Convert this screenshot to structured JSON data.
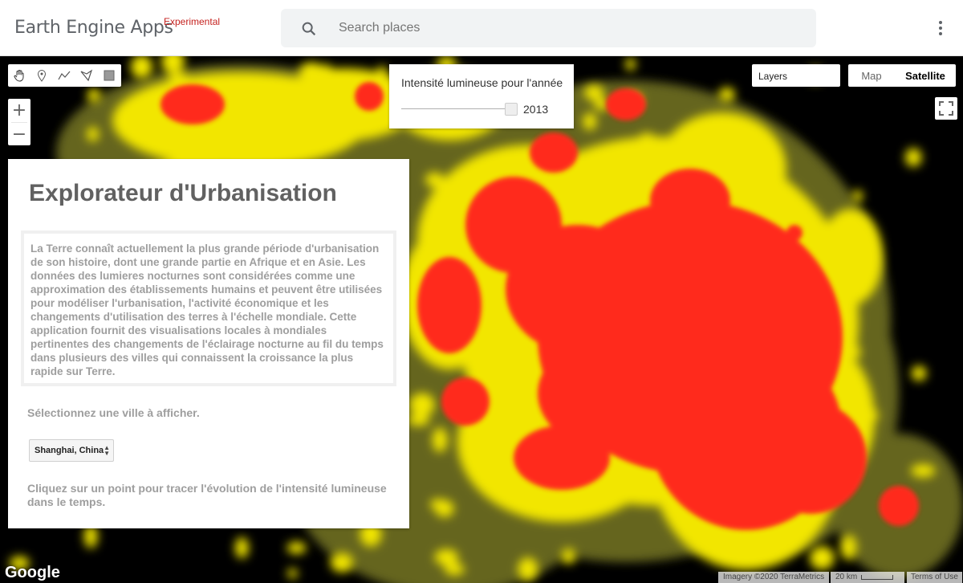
{
  "header": {
    "app_name": "Earth Engine Apps",
    "badge": "Experimental",
    "search_placeholder": "Search places"
  },
  "toolbar": {
    "tools": [
      "hand-icon",
      "marker-icon",
      "line-icon",
      "polygon-icon",
      "rectangle-icon"
    ]
  },
  "zoom": {
    "in_label": "+",
    "out_label": "−"
  },
  "year_panel": {
    "title": "Intensité lumineuse pour l'année",
    "year": "2013",
    "slider_level": 1.0
  },
  "layers": {
    "label": "Layers"
  },
  "map_type": {
    "map_label": "Map",
    "satellite_label": "Satellite",
    "selected": "Satellite"
  },
  "info_panel": {
    "title": "Explorateur d'Urbanisation",
    "description": "La Terre connaît actuellement la plus grande période d'urbanisation de son histoire, dont une grande partie en Afrique et en Asie. Les données des lumieres nocturnes sont considérées comme une approximation des établissements humains et peuvent être utilisées pour modéliser l'urbanisation, l'activité économique et les changements d'utilisation des terres à l'échelle mondiale. Cette application fournit des visualisations locales à mondiales pertinentes des changements de l'éclairage nocturne au fil du temps dans plusieurs des villes qui connaissent la croissance la plus rapide sur Terre.",
    "select_label": "Sélectionnez une ville à afficher.",
    "selected_city": "Shanghai, China",
    "click_hint": "Cliquez sur un point pour tracer l'évolution de l'intensité lumineuse dans le temps."
  },
  "footer": {
    "logo": "Google",
    "attribution": "Imagery ©2020 TerraMetrics",
    "scale": "20 km",
    "terms": "Terms of Use"
  },
  "colors": {
    "heat_high": "#ff2a1a",
    "heat_mid": "#ffea00",
    "heat_low": "#7a7a20",
    "background": "#000000",
    "badge": "#c5221f"
  }
}
